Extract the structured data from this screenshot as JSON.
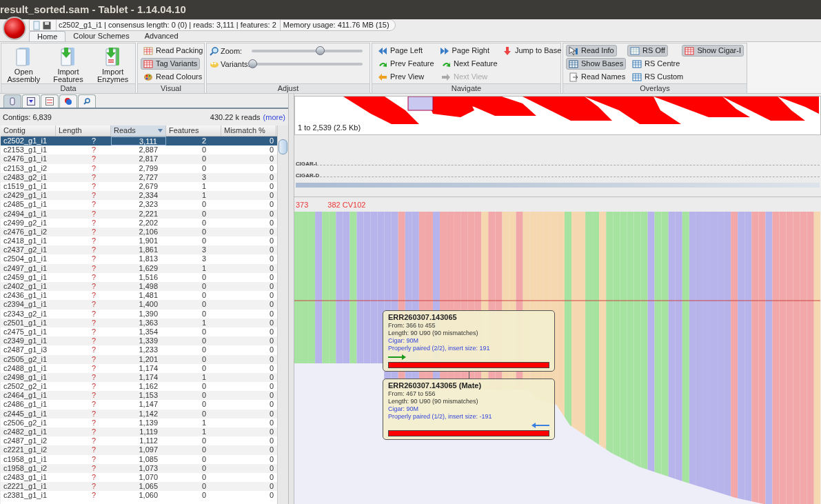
{
  "window": {
    "title": "result_sorted.sam - Tablet - 1.14.04.10"
  },
  "quick_access": {
    "status": "c2502_g1_i1 | consensus length: 0 (0) | reads: 3,111 | features: 2",
    "memory": "Memory usage: 411.76 MB (15)"
  },
  "ribbon_tabs": [
    {
      "label": "Home",
      "selected": true
    },
    {
      "label": "Colour Schemes",
      "selected": false
    },
    {
      "label": "Advanced",
      "selected": false
    }
  ],
  "ribbon_groups": [
    {
      "label": "Data",
      "kind": "large",
      "items": [
        {
          "label": "Open Assembly"
        },
        {
          "label": "Import Features"
        },
        {
          "label": "Import Enzymes"
        }
      ]
    },
    {
      "label": "Visual",
      "kind": "grid",
      "rows": [
        [
          {
            "label": "Read Packing",
            "selected": false
          }
        ],
        [
          {
            "label": "Tag Variants",
            "selected": true
          }
        ],
        [
          {
            "label": "Read Colours",
            "selected": false
          }
        ]
      ]
    },
    {
      "label": "Adjust",
      "kind": "sliders",
      "sliders": [
        {
          "label": "Zoom:",
          "level": 0.62
        },
        {
          "label": "Variants:",
          "level": 0
        }
      ]
    },
    {
      "label": "Navigate",
      "kind": "grid",
      "rows": [
        [
          {
            "label": "Page Left",
            "disabled": false
          },
          {
            "label": "Page Right",
            "disabled": false
          },
          {
            "label": "Jump to Base",
            "disabled": false
          }
        ],
        [
          {
            "label": "Prev Feature",
            "disabled": false
          },
          {
            "label": "Next Feature",
            "disabled": false
          }
        ],
        [
          {
            "label": "Prev View",
            "disabled": false
          },
          {
            "label": "Next View",
            "disabled": true
          }
        ]
      ]
    },
    {
      "label": "Overlays",
      "kind": "grid",
      "rows": [
        [
          {
            "label": "Read Info",
            "selected": true
          },
          {
            "label": "RS Off",
            "selected": true
          },
          {
            "label": "Show Cigar-I",
            "selected": true
          }
        ],
        [
          {
            "label": "Show Bases",
            "selected": true
          },
          {
            "label": "RS Centre",
            "selected": false
          }
        ],
        [
          {
            "label": "Read Names",
            "selected": false
          },
          {
            "label": "RS Custom",
            "selected": false
          }
        ]
      ]
    }
  ],
  "panel_tabs": [
    {
      "selected": true
    },
    {
      "selected": false
    },
    {
      "selected": false
    },
    {
      "selected": false
    },
    {
      "selected": false
    }
  ],
  "contigs_summary": {
    "count": "Contigs: 6,839",
    "reads": "430.22 k reads",
    "more_link": "(more)"
  },
  "table": {
    "columns": [
      {
        "label": "Contig",
        "sorted": false
      },
      {
        "label": "Length",
        "sorted": false
      },
      {
        "label": "Reads",
        "sorted": true
      },
      {
        "label": "Features",
        "sorted": false
      },
      {
        "label": "Mismatch %",
        "sorted": false
      }
    ],
    "rows": [
      {
        "cells": [
          "c2502_g1_i1",
          "?",
          "3,111",
          "2",
          "0"
        ],
        "selected": true
      },
      {
        "cells": [
          "c2153_g1_i1",
          "?",
          "2,887",
          "0",
          "0"
        ],
        "selected": false
      },
      {
        "cells": [
          "c2476_g1_i1",
          "?",
          "2,817",
          "0",
          "0"
        ],
        "selected": false
      },
      {
        "cells": [
          "c2153_g1_i2",
          "?",
          "2,799",
          "0",
          "0"
        ],
        "selected": false
      },
      {
        "cells": [
          "c2483_g2_i1",
          "?",
          "2,727",
          "3",
          "0"
        ],
        "selected": false
      },
      {
        "cells": [
          "c1519_g1_i1",
          "?",
          "2,679",
          "1",
          "0"
        ],
        "selected": false
      },
      {
        "cells": [
          "c2429_g1_i1",
          "?",
          "2,334",
          "1",
          "0"
        ],
        "selected": false
      },
      {
        "cells": [
          "c2485_g1_i1",
          "?",
          "2,323",
          "0",
          "0"
        ],
        "selected": false
      },
      {
        "cells": [
          "c2494_g1_i1",
          "?",
          "2,221",
          "0",
          "0"
        ],
        "selected": false
      },
      {
        "cells": [
          "c2499_g2_i1",
          "?",
          "2,202",
          "0",
          "0"
        ],
        "selected": false
      },
      {
        "cells": [
          "c2476_g1_i2",
          "?",
          "2,106",
          "0",
          "0"
        ],
        "selected": false
      },
      {
        "cells": [
          "c2418_g1_i1",
          "?",
          "1,901",
          "0",
          "0"
        ],
        "selected": false
      },
      {
        "cells": [
          "c2437_g2_i1",
          "?",
          "1,861",
          "3",
          "0"
        ],
        "selected": false
      },
      {
        "cells": [
          "c2504_g1_i1",
          "?",
          "1,813",
          "3",
          "0"
        ],
        "selected": false
      },
      {
        "cells": [
          "c2497_g1_i1",
          "?",
          "1,629",
          "1",
          "0"
        ],
        "selected": false
      },
      {
        "cells": [
          "c2459_g1_i1",
          "?",
          "1,516",
          "0",
          "0"
        ],
        "selected": false
      },
      {
        "cells": [
          "c2402_g1_i1",
          "?",
          "1,498",
          "0",
          "0"
        ],
        "selected": false
      },
      {
        "cells": [
          "c2436_g1_i1",
          "?",
          "1,481",
          "0",
          "0"
        ],
        "selected": false
      },
      {
        "cells": [
          "c2394_g1_i1",
          "?",
          "1,400",
          "0",
          "0"
        ],
        "selected": false
      },
      {
        "cells": [
          "c2343_g2_i1",
          "?",
          "1,390",
          "0",
          "0"
        ],
        "selected": false
      },
      {
        "cells": [
          "c2501_g1_i1",
          "?",
          "1,363",
          "1",
          "0"
        ],
        "selected": false
      },
      {
        "cells": [
          "c2475_g1_i1",
          "?",
          "1,354",
          "0",
          "0"
        ],
        "selected": false
      },
      {
        "cells": [
          "c2349_g1_i1",
          "?",
          "1,339",
          "0",
          "0"
        ],
        "selected": false
      },
      {
        "cells": [
          "c2487_g1_i3",
          "?",
          "1,233",
          "0",
          "0"
        ],
        "selected": false
      },
      {
        "cells": [
          "c2505_g2_i1",
          "?",
          "1,201",
          "0",
          "0"
        ],
        "selected": false
      },
      {
        "cells": [
          "c2488_g1_i1",
          "?",
          "1,174",
          "0",
          "0"
        ],
        "selected": false
      },
      {
        "cells": [
          "c2498_g1_i1",
          "?",
          "1,174",
          "1",
          "0"
        ],
        "selected": false
      },
      {
        "cells": [
          "c2502_g2_i1",
          "?",
          "1,162",
          "0",
          "0"
        ],
        "selected": false
      },
      {
        "cells": [
          "c2464_g1_i1",
          "?",
          "1,153",
          "0",
          "0"
        ],
        "selected": false
      },
      {
        "cells": [
          "c2486_g1_i1",
          "?",
          "1,147",
          "0",
          "0"
        ],
        "selected": false
      },
      {
        "cells": [
          "c2445_g1_i1",
          "?",
          "1,142",
          "0",
          "0"
        ],
        "selected": false
      },
      {
        "cells": [
          "c2506_g2_i1",
          "?",
          "1,139",
          "1",
          "0"
        ],
        "selected": false
      },
      {
        "cells": [
          "c2482_g1_i1",
          "?",
          "1,119",
          "1",
          "0"
        ],
        "selected": false
      },
      {
        "cells": [
          "c2487_g1_i2",
          "?",
          "1,112",
          "0",
          "0"
        ],
        "selected": false
      },
      {
        "cells": [
          "c2221_g1_i2",
          "?",
          "1,097",
          "0",
          "0"
        ],
        "selected": false
      },
      {
        "cells": [
          "c1958_g1_i1",
          "?",
          "1,085",
          "0",
          "0"
        ],
        "selected": false
      },
      {
        "cells": [
          "c1958_g1_i2",
          "?",
          "1,073",
          "0",
          "0"
        ],
        "selected": false
      },
      {
        "cells": [
          "c2483_g1_i1",
          "?",
          "1,070",
          "0",
          "0"
        ],
        "selected": false
      },
      {
        "cells": [
          "c2221_g1_i1",
          "?",
          "1,065",
          "0",
          "0"
        ],
        "selected": false
      },
      {
        "cells": [
          "c2381_g1_i1",
          "?",
          "1,060",
          "0",
          "0"
        ],
        "selected": false
      }
    ]
  },
  "overview": {
    "range": "1 to 2,539 (2.5 Kb)"
  },
  "tracks": [
    {
      "label": "CIGAR-I"
    },
    {
      "label": "CIGAR-D"
    }
  ],
  "ruler": {
    "labels": [
      "373",
      "382 CV102"
    ]
  },
  "read_popups": [
    {
      "title": "ERR260307.143065",
      "from": "From: 366 to 455",
      "length": "Length: 90 U90 (90 mismatches)",
      "cigar": "Cigar: 90M",
      "pairing": "Properly paired (2/2), insert size: 191",
      "kind": "forward"
    },
    {
      "title": "ERR260307.143065 (Mate)",
      "from": "From: 467 to 556",
      "length": "Length: 90 U90 (90 mismatches)",
      "cigar": "Cigar: 90M",
      "pairing": "Properly paired (1/2), insert size: -191",
      "kind": "reverse"
    }
  ]
}
